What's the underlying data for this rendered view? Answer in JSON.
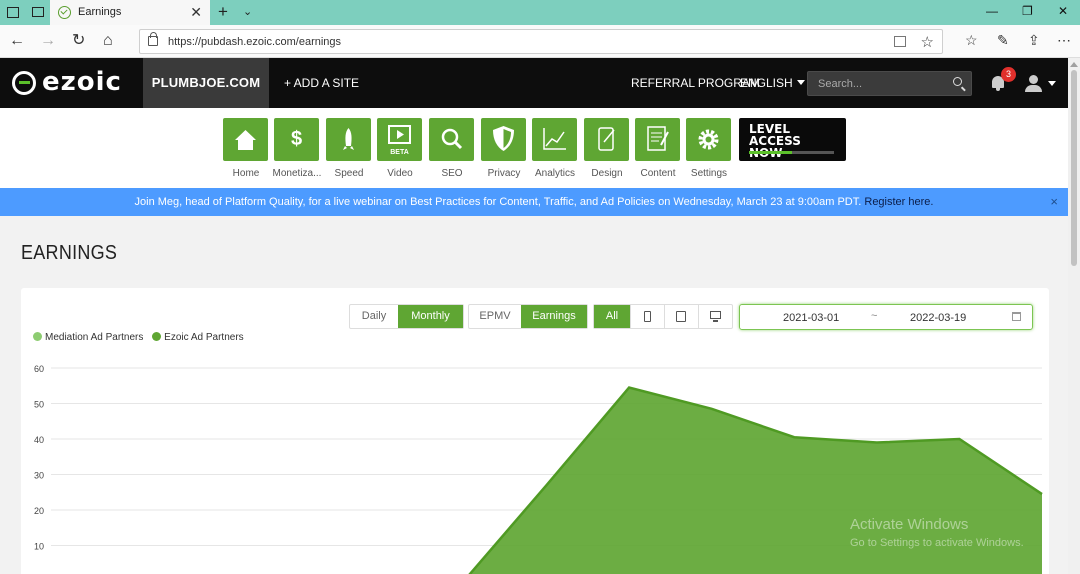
{
  "browser": {
    "tab_title": "Earnings",
    "url": "https://pubdash.ezoic.com/earnings"
  },
  "header": {
    "logo_text": "ezoic",
    "site": "PLUMBJOE.COM",
    "add_site": "+ ADD A SITE",
    "referral": "REFERRAL PROGRAM",
    "language": "ENGLISH",
    "search_placeholder": "Search...",
    "notification_count": "3"
  },
  "nav": {
    "items": [
      {
        "label": "Home",
        "icon": "house-icon"
      },
      {
        "label": "Monetiza...",
        "icon": "dollar-icon"
      },
      {
        "label": "Speed",
        "icon": "rocket-icon"
      },
      {
        "label": "Video",
        "icon": "video-icon",
        "badge": "BETA"
      },
      {
        "label": "SEO",
        "icon": "magnifier-icon"
      },
      {
        "label": "Privacy",
        "icon": "shield-icon"
      },
      {
        "label": "Analytics",
        "icon": "line-chart-icon"
      },
      {
        "label": "Design",
        "icon": "design-icon"
      },
      {
        "label": "Content",
        "icon": "document-icon"
      },
      {
        "label": "Settings",
        "icon": "gear-icon"
      }
    ],
    "level_access": "LEVEL ACCESS NOW",
    "level_progress": 0.5
  },
  "banner": {
    "text": "Join Meg, head of Platform Quality, for a live webinar on Best Practices for Content, Traffic, and Ad Policies on Wednesday, March 23 at 9:00am PDT.",
    "link": "Register here.",
    "close": "×"
  },
  "page": {
    "title": "EARNINGS"
  },
  "controls": {
    "period": [
      "Daily",
      "Monthly"
    ],
    "period_selected": "Monthly",
    "metric": [
      "EPMV",
      "Earnings"
    ],
    "metric_selected": "Earnings",
    "device_all": "All",
    "date_start": "2021-03-01",
    "date_sep": "~",
    "date_end": "2022-03-19"
  },
  "watermark": {
    "line1": "Activate Windows",
    "line2": "Go to Settings to activate Windows."
  },
  "colors": {
    "accent": "#5fa633",
    "mediation": "#8dcc71",
    "ezoic": "#5fa633",
    "banner": "#4d9bff"
  },
  "chart_data": {
    "type": "area",
    "legend": [
      "Mediation Ad Partners",
      "Ezoic Ad Partners"
    ],
    "legend_position": "top-left",
    "ylim": [
      0,
      60
    ],
    "y_ticks": [
      60,
      50,
      40,
      30,
      20,
      10
    ],
    "grid": true,
    "series": [
      {
        "name": "Ezoic Ad Partners",
        "values": [
          0,
          0,
          0,
          0,
          0,
          0,
          27,
          54.5,
          48.5,
          40.5,
          39,
          40,
          24.5
        ]
      },
      {
        "name": "Mediation Ad Partners",
        "values": [
          0,
          0,
          0,
          0,
          0,
          0,
          0,
          0,
          0,
          0,
          0,
          0,
          0
        ]
      }
    ]
  }
}
